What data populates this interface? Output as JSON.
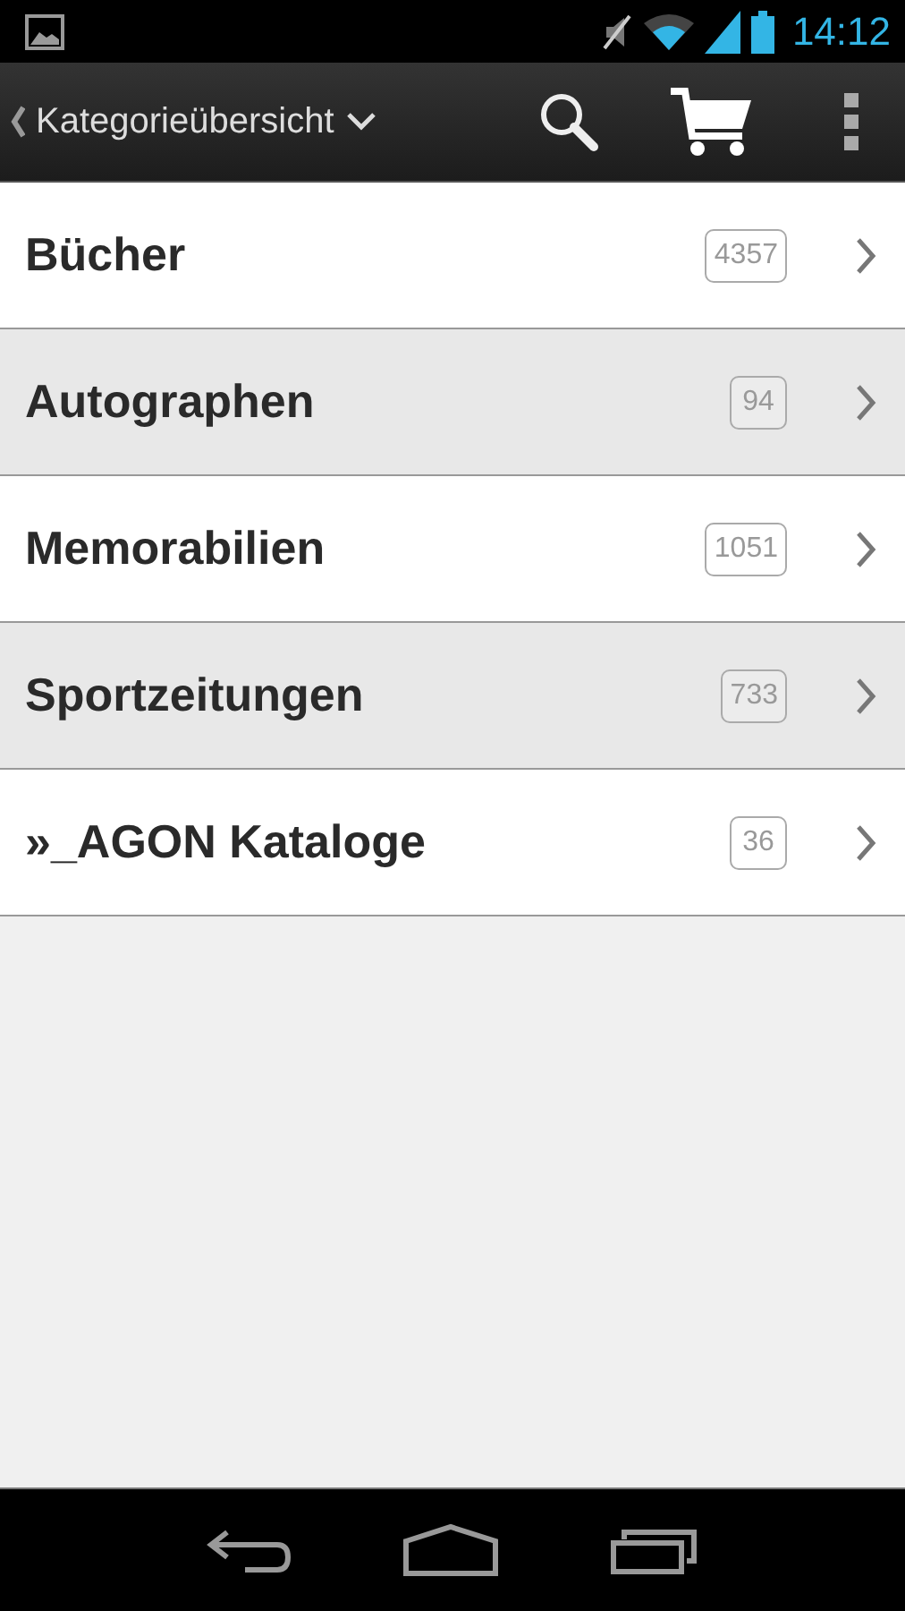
{
  "status_bar": {
    "time": "14:12"
  },
  "action_bar": {
    "title": "Kategorieübersicht"
  },
  "categories": [
    {
      "name": "Bücher",
      "count": "4357",
      "shaded": false
    },
    {
      "name": "Autographen",
      "count": "94",
      "shaded": true
    },
    {
      "name": "Memorabilien",
      "count": "1051",
      "shaded": false
    },
    {
      "name": "Sportzeitungen",
      "count": "733",
      "shaded": true
    },
    {
      "name": "»_AGON Kataloge",
      "count": "36",
      "shaded": false
    }
  ]
}
